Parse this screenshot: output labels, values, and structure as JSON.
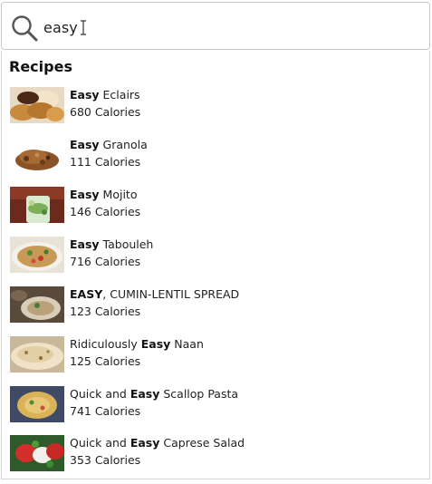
{
  "search": {
    "value": "easy",
    "icon": "search-icon"
  },
  "results": {
    "section_title": "Recipes",
    "items": [
      {
        "pre": "",
        "match": "Easy",
        "post": " Eclairs",
        "calories": "680 Calories",
        "image": "eclairs-image"
      },
      {
        "pre": "",
        "match": "Easy",
        "post": " Granola",
        "calories": "111 Calories",
        "image": "granola-image"
      },
      {
        "pre": "",
        "match": "Easy",
        "post": " Mojito",
        "calories": "146 Calories",
        "image": "mojito-image"
      },
      {
        "pre": "",
        "match": "Easy",
        "post": " Tabouleh",
        "calories": "716 Calories",
        "image": "tabouleh-image"
      },
      {
        "pre": "",
        "match": "EASY",
        "post": ", CUMIN-LENTIL SPREAD",
        "calories": "123 Calories",
        "image": "lentil-spread-image"
      },
      {
        "pre": "Ridiculously ",
        "match": "Easy",
        "post": " Naan",
        "calories": "125 Calories",
        "image": "naan-image"
      },
      {
        "pre": "Quick and ",
        "match": "Easy",
        "post": " Scallop Pasta",
        "calories": "741 Calories",
        "image": "scallop-pasta-image"
      },
      {
        "pre": "Quick and ",
        "match": "Easy",
        "post": " Caprese Salad",
        "calories": "353 Calories",
        "image": "caprese-salad-image"
      }
    ]
  },
  "colors": {
    "border": "#c9c9c9",
    "text": "#222222",
    "icon": "#555555"
  }
}
